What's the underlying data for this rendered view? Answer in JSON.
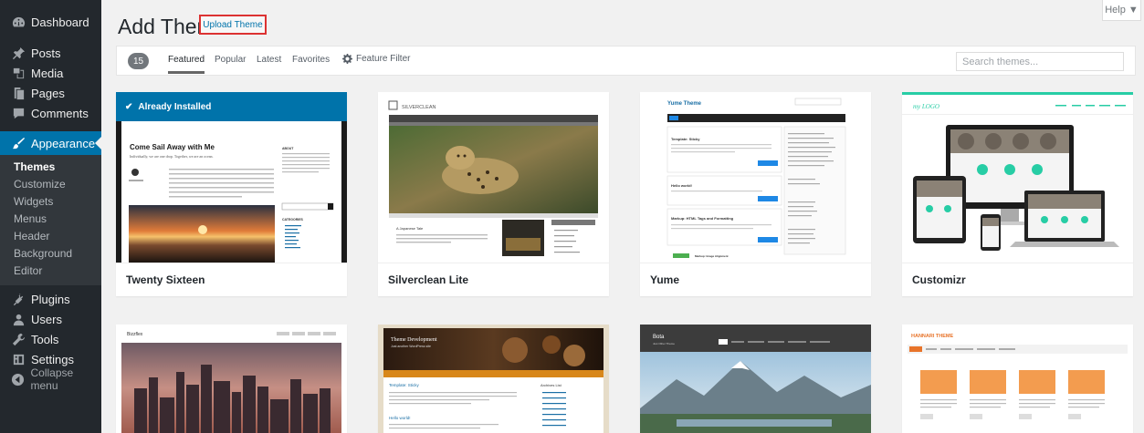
{
  "sidebar": {
    "items": [
      {
        "label": "Dashboard",
        "icon": "dashboard-icon"
      },
      {
        "label": "Posts",
        "icon": "pin-icon"
      },
      {
        "label": "Media",
        "icon": "media-icon"
      },
      {
        "label": "Pages",
        "icon": "pages-icon"
      },
      {
        "label": "Comments",
        "icon": "comment-icon"
      },
      {
        "label": "Appearance",
        "icon": "brush-icon"
      },
      {
        "label": "Plugins",
        "icon": "plugin-icon"
      },
      {
        "label": "Users",
        "icon": "users-icon"
      },
      {
        "label": "Tools",
        "icon": "wrench-icon"
      },
      {
        "label": "Settings",
        "icon": "settings-icon"
      },
      {
        "label": "Collapse menu",
        "icon": "collapse-icon"
      }
    ],
    "submenu": [
      "Themes",
      "Customize",
      "Widgets",
      "Menus",
      "Header",
      "Background",
      "Editor"
    ],
    "active_item": "Appearance",
    "current_sub": "Themes"
  },
  "header": {
    "title": "Add Themes",
    "upload_button": "Upload Theme",
    "help": "Help ▼"
  },
  "filter": {
    "count": "15",
    "tabs": [
      "Featured",
      "Popular",
      "Latest",
      "Favorites"
    ],
    "active_tab": "Featured",
    "feature_filter": "Feature Filter",
    "search_placeholder": "Search themes..."
  },
  "themes": [
    {
      "name": "Twenty Sixteen",
      "installed_label": "Already Installed",
      "preview": {
        "headline": "Come Sail Away with Me",
        "tagline": "Individually, we are one drop. Together, we are an ocean.",
        "widget_title": "ABOUT",
        "widget_title2": "CATEGORIES"
      }
    },
    {
      "name": "Silverclean Lite",
      "preview": {
        "logo": "SILVERCLEAN",
        "post_title": "A Japanese Tale"
      }
    },
    {
      "name": "Yume",
      "preview": {
        "logo": "Yume Theme",
        "post1": "Template: Sticky",
        "post2": "Hello world!",
        "post3": "Markup: HTML Tags and Formatting",
        "post4": "Markup: Image Alignment",
        "read_more": "Read More"
      }
    },
    {
      "name": "Customizr",
      "preview": {
        "logo": "my LOGO"
      }
    },
    {
      "name": "",
      "preview": {
        "logo": "Bizzflex"
      }
    },
    {
      "name": "",
      "preview": {
        "title": "Theme Development",
        "subtitle": "Just another WordPress site",
        "post": "Template: Sticky",
        "post2": "Hello world!",
        "sidebar_title": "Archives List"
      }
    },
    {
      "name": "",
      "preview": {
        "logo": "Bota",
        "subtitle": "Just Other Theme"
      }
    },
    {
      "name": "",
      "preview": {
        "logo": "HANNARI THEME"
      }
    }
  ],
  "colors": {
    "sidebar_bg": "#23282d",
    "active_blue": "#0073aa",
    "highlight_border": "#dc3232"
  }
}
